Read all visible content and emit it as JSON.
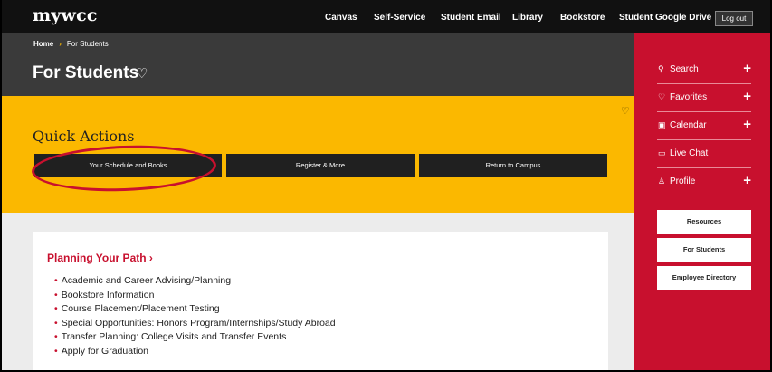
{
  "logo": "mywcc",
  "topnav": {
    "links": [
      "Canvas",
      "Self-Service",
      "Student Email",
      "Library",
      "Bookstore",
      "Student Google Drive"
    ],
    "logout": "Log out"
  },
  "breadcrumb": {
    "home": "Home",
    "separator": "›",
    "current": "For Students"
  },
  "page": {
    "title": "For Students"
  },
  "quick_actions": {
    "title": "Quick Actions",
    "buttons": [
      "Your Schedule and Books",
      "Register & More",
      "Return to Campus"
    ]
  },
  "planning": {
    "title": "Planning Your Path ›",
    "items": [
      "Academic and Career Advising/Planning",
      "Bookstore Information",
      "Course Placement/Placement Testing",
      "Special Opportunities: Honors Program/Internships/Study Abroad",
      "Transfer Planning: College Visits and Transfer Events",
      "Apply for Graduation"
    ]
  },
  "sidebar": {
    "items": [
      {
        "label": "Search",
        "icon": "search-icon",
        "plus": "+"
      },
      {
        "label": "Favorites",
        "icon": "heart-icon",
        "plus": "+"
      },
      {
        "label": "Calendar",
        "icon": "calendar-icon",
        "plus": "+"
      },
      {
        "label": "Live Chat",
        "icon": "chat-icon",
        "plus": ""
      },
      {
        "label": "Profile",
        "icon": "user-icon",
        "plus": "+"
      }
    ],
    "buttons": [
      "Resources",
      "For Students",
      "Employee Directory"
    ]
  },
  "colors": {
    "accent_red": "#c8102e",
    "yellow": "#fbb800",
    "dark": "#3a3a3a"
  }
}
